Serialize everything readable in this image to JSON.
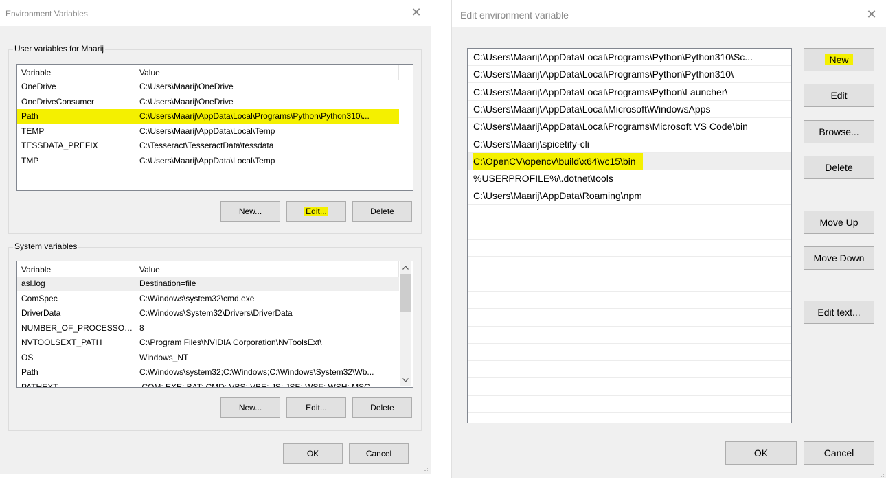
{
  "left_dialog": {
    "title": "Environment Variables",
    "close_glyph": "✕",
    "user_group": {
      "label": "User variables for Maarij",
      "headers": [
        "Variable",
        "Value"
      ],
      "rows": [
        {
          "variable": "OneDrive",
          "value": "C:\\Users\\Maarij\\OneDrive"
        },
        {
          "variable": "OneDriveConsumer",
          "value": "C:\\Users\\Maarij\\OneDrive"
        },
        {
          "variable": "Path",
          "value": "C:\\Users\\Maarij\\AppData\\Local\\Programs\\Python\\Python310\\...",
          "highlighted": true
        },
        {
          "variable": "TEMP",
          "value": "C:\\Users\\Maarij\\AppData\\Local\\Temp"
        },
        {
          "variable": "TESSDATA_PREFIX",
          "value": "C:\\Tesseract\\TesseractData\\tessdata"
        },
        {
          "variable": "TMP",
          "value": "C:\\Users\\Maarij\\AppData\\Local\\Temp"
        }
      ],
      "buttons": {
        "new": "New...",
        "edit": "Edit...",
        "delete": "Delete"
      }
    },
    "system_group": {
      "label": "System variables",
      "headers": [
        "Variable",
        "Value"
      ],
      "rows": [
        {
          "variable": "asl.log",
          "value": "Destination=file",
          "selected": true
        },
        {
          "variable": "ComSpec",
          "value": "C:\\Windows\\system32\\cmd.exe"
        },
        {
          "variable": "DriverData",
          "value": "C:\\Windows\\System32\\Drivers\\DriverData"
        },
        {
          "variable": "NUMBER_OF_PROCESSORS",
          "value": "8"
        },
        {
          "variable": "NVTOOLSEXT_PATH",
          "value": "C:\\Program Files\\NVIDIA Corporation\\NvToolsExt\\"
        },
        {
          "variable": "OS",
          "value": "Windows_NT"
        },
        {
          "variable": "Path",
          "value": "C:\\Windows\\system32;C:\\Windows;C:\\Windows\\System32\\Wb..."
        },
        {
          "variable": "PATHEXT",
          "value": ".COM;.EXE;.BAT;.CMD;.VBS;.VBE;.JS;.JSE;.WSF;.WSH;.MSC"
        }
      ],
      "buttons": {
        "new": "New...",
        "edit": "Edit...",
        "delete": "Delete"
      }
    },
    "ok": "OK",
    "cancel": "Cancel"
  },
  "right_dialog": {
    "title": "Edit environment variable",
    "close_glyph": "✕",
    "entries": [
      {
        "text": "C:\\Users\\Maarij\\AppData\\Local\\Programs\\Python\\Python310\\Sc..."
      },
      {
        "text": "C:\\Users\\Maarij\\AppData\\Local\\Programs\\Python\\Python310\\"
      },
      {
        "text": "C:\\Users\\Maarij\\AppData\\Local\\Programs\\Python\\Launcher\\"
      },
      {
        "text": "C:\\Users\\Maarij\\AppData\\Local\\Microsoft\\WindowsApps"
      },
      {
        "text": "C:\\Users\\Maarij\\AppData\\Local\\Programs\\Microsoft VS Code\\bin"
      },
      {
        "text": "C:\\Users\\Maarij\\spicetify-cli"
      },
      {
        "text": "C:\\OpenCV\\opencv\\build\\x64\\vc15\\bin",
        "highlighted": true,
        "selected": true
      },
      {
        "text": "%USERPROFILE%\\.dotnet\\tools"
      },
      {
        "text": "C:\\Users\\Maarij\\AppData\\Roaming\\npm"
      }
    ],
    "empty_rows": 12,
    "buttons": {
      "new": "New",
      "edit": "Edit",
      "browse": "Browse...",
      "delete": "Delete",
      "move_up": "Move Up",
      "move_down": "Move Down",
      "edit_text": "Edit text...",
      "ok": "OK",
      "cancel": "Cancel"
    }
  },
  "colors": {
    "highlight": "#f4f000",
    "dialog_bg": "#f0f0f0",
    "selection": "#eeeeee"
  },
  "icons": {
    "close": "close-icon",
    "scroll_up": "chevron-up-icon",
    "scroll_down": "chevron-down-icon",
    "resize": "resize-grip-icon"
  }
}
